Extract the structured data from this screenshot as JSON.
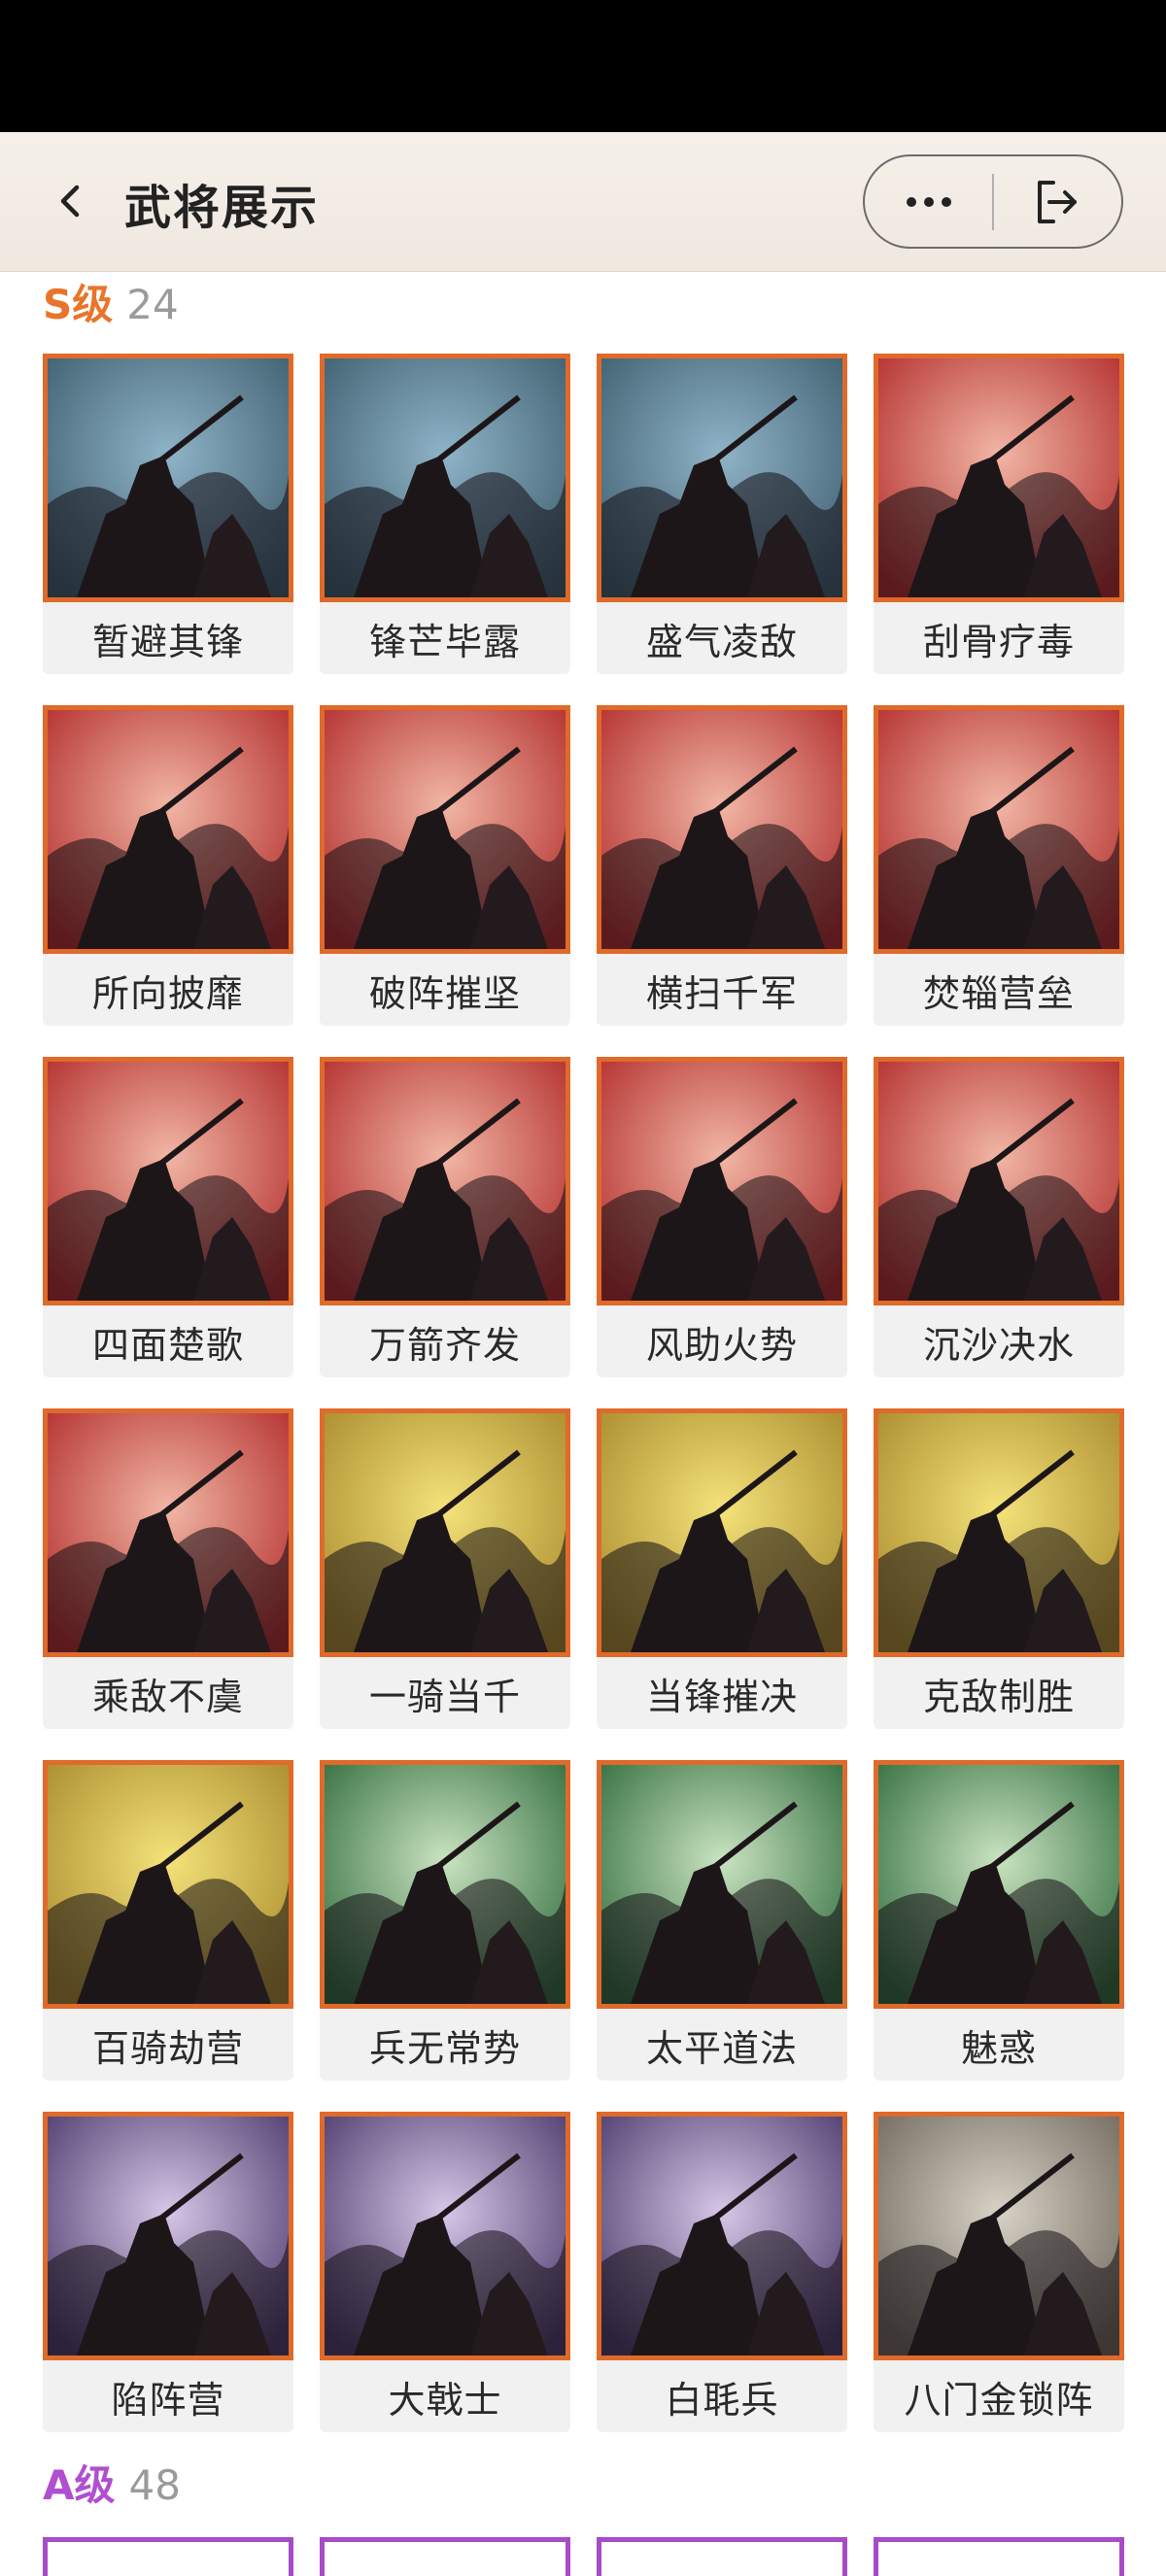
{
  "header": {
    "title": "武将展示",
    "back_icon": "chevron-left-icon",
    "more_icon": "more-dots-icon",
    "exit_icon": "exit-icon"
  },
  "sections": [
    {
      "grade": "S级",
      "count": "24",
      "grade_color": "#e8752b",
      "items": [
        {
          "name": "暂避其锋",
          "theme": "blue"
        },
        {
          "name": "锋芒毕露",
          "theme": "blue"
        },
        {
          "name": "盛气凌敌",
          "theme": "blue"
        },
        {
          "name": "刮骨疗毒",
          "theme": "red"
        },
        {
          "name": "所向披靡",
          "theme": "red"
        },
        {
          "name": "破阵摧坚",
          "theme": "red"
        },
        {
          "name": "横扫千军",
          "theme": "red"
        },
        {
          "name": "焚辎营垒",
          "theme": "red"
        },
        {
          "name": "四面楚歌",
          "theme": "red"
        },
        {
          "name": "万箭齐发",
          "theme": "red"
        },
        {
          "name": "风助火势",
          "theme": "red"
        },
        {
          "name": "沉沙决水",
          "theme": "red"
        },
        {
          "name": "乘敌不虞",
          "theme": "red"
        },
        {
          "name": "一骑当千",
          "theme": "yellow"
        },
        {
          "name": "当锋摧决",
          "theme": "yellow"
        },
        {
          "name": "克敌制胜",
          "theme": "yellow"
        },
        {
          "name": "百骑劫营",
          "theme": "yellow"
        },
        {
          "name": "兵无常势",
          "theme": "green"
        },
        {
          "name": "太平道法",
          "theme": "green"
        },
        {
          "name": "魅惑",
          "theme": "green"
        },
        {
          "name": "陷阵营",
          "theme": "purple"
        },
        {
          "name": "大戟士",
          "theme": "purple"
        },
        {
          "name": "白毦兵",
          "theme": "purple"
        },
        {
          "name": "八门金锁阵",
          "theme": "gray"
        }
      ]
    },
    {
      "grade": "A级",
      "count": "48",
      "grade_color": "#b04fd0"
    }
  ],
  "colors": {
    "card_border_s": "#e06a2a",
    "card_border_a": "#a84bc8",
    "theme_blue": [
      "#8fb3c7",
      "#3d5e6e"
    ],
    "theme_red": [
      "#f1b6a4",
      "#b22b2b"
    ],
    "theme_yellow": [
      "#f4e27a",
      "#a88a2b"
    ],
    "theme_green": [
      "#c9e3c0",
      "#2f6b3c"
    ],
    "theme_purple": [
      "#d6c6e7",
      "#4b3a6a"
    ],
    "theme_gray": [
      "#d7d1c6",
      "#6f675c"
    ]
  }
}
